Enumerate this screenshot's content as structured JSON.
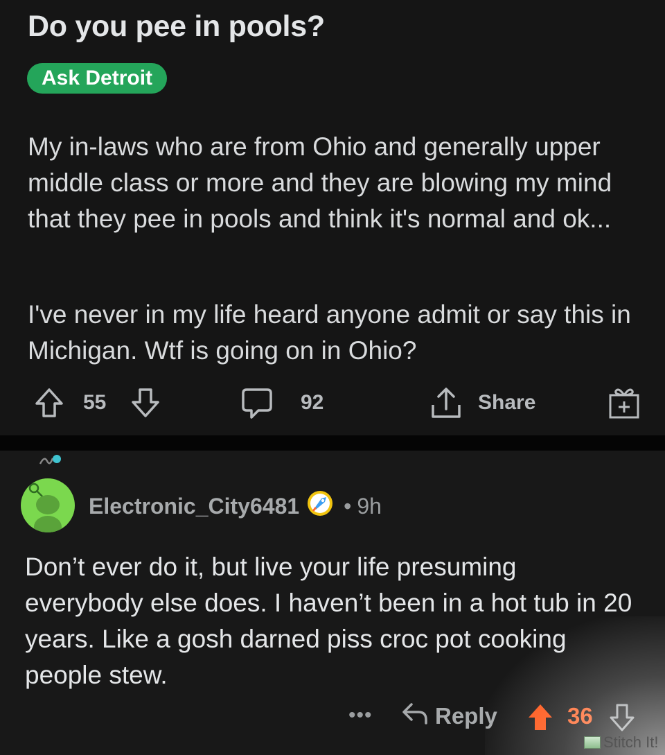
{
  "post": {
    "title": "Do you pee in pools?",
    "flair": "Ask Detroit",
    "body": [
      "My in-laws who are from Ohio and generally upper middle class or more and they are blowing my mind that they pee in pools and think it's normal and ok...",
      "I've never in my life heard anyone admit or say this in Michigan. Wtf is going on in Ohio?"
    ],
    "upvotes": "55",
    "comments": "92",
    "share_label": "Share",
    "icons": {
      "upvote": "arrow-up-outline-icon",
      "downvote": "arrow-down-outline-icon",
      "comment": "speech-bubble-icon",
      "share": "share-upload-icon",
      "award": "gift-box-icon"
    }
  },
  "comment": {
    "username": "Electronic_City6481",
    "time": "9h",
    "separator": "•",
    "body": "Don’t ever do it, but live your life presuming everybody else does. I haven’t been in a hot tub in 20 years. Like a gosh darned piss croc pot cooking people stew.",
    "more_label": "•••",
    "reply_label": "Reply",
    "score": "36",
    "avatar_color": "#7bd84e",
    "upvote_color": "#ff5414"
  },
  "watermark": {
    "label": "Stitch It!"
  },
  "colors": {
    "background": "#151515",
    "flair": "#24a55a",
    "text": "#d9dbdd",
    "muted": "#b8bbbe",
    "score_active": "#ff6a30"
  }
}
